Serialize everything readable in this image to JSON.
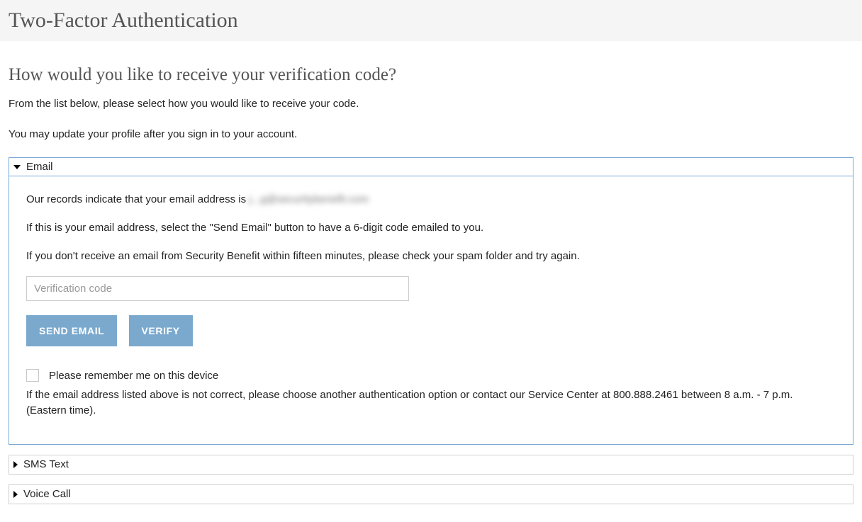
{
  "header": {
    "title": "Two-Factor Authentication"
  },
  "page": {
    "subtitle": "How would you like to receive your verification code?",
    "intro1": "From the list below, please select how you would like to receive your code.",
    "intro2": "You may update your profile after you sign in to your account."
  },
  "email_panel": {
    "label": "Email",
    "records_prefix": "Our records indicate that your email address is ",
    "masked_email": "j...g@securitybenefit.com",
    "instruction1": "If this is your email address, select the \"Send Email\" button to have a 6-digit code emailed to you.",
    "instruction2": "If you don't receive an email from Security Benefit within fifteen minutes, please check your spam folder and try again.",
    "code_placeholder": "Verification code",
    "send_button": "Send Email",
    "verify_button": "Verify",
    "remember_label": "Please remember me on this device",
    "footnote": "If the email address listed above is not correct, please choose another authentication option or contact our Service Center at 800.888.2461 between 8 a.m. - 7 p.m. (Eastern time)."
  },
  "sms_panel": {
    "label": "SMS Text"
  },
  "voice_panel": {
    "label": "Voice Call"
  }
}
